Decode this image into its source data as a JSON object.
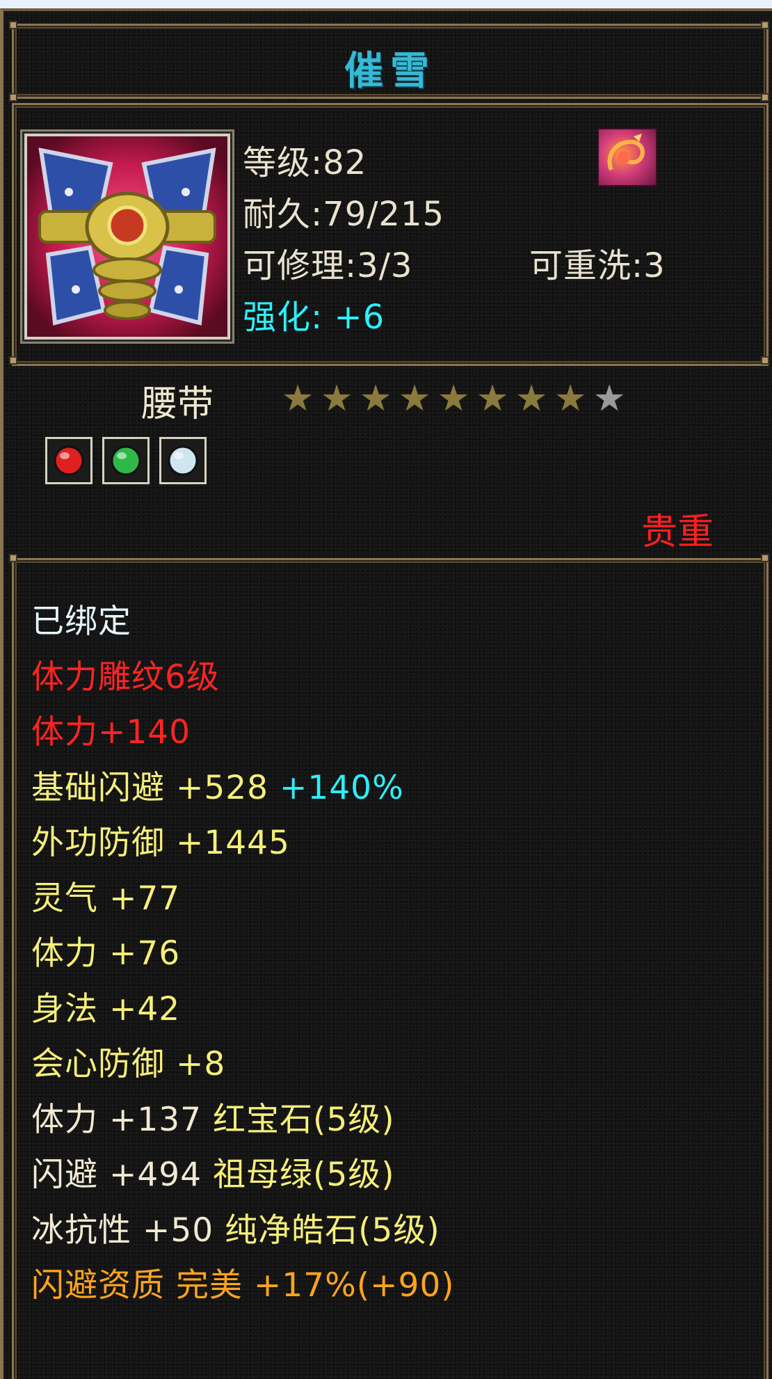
{
  "item": {
    "name": "催雪",
    "level_text": "等级:82",
    "durability_text": "耐久:79/215",
    "repair_text": "可修理:3/3",
    "rewash_text": "可重洗:3",
    "enhance_text": "强化: +6",
    "type": "腰带",
    "quality": "贵重",
    "stars": {
      "filled": 8,
      "total": 9
    },
    "gems": [
      {
        "icon": "ruby-gem-icon",
        "color": "#e02020"
      },
      {
        "icon": "emerald-gem-icon",
        "color": "#2fb84a"
      },
      {
        "icon": "diamond-gem-icon",
        "color": "#cfe6f0"
      }
    ]
  },
  "colors": {
    "title": "#35b9d6",
    "enhance": "#2cf0f8",
    "quality": "#ff1f1f",
    "bound": "#e6f6ff",
    "engrave": "#ff2424",
    "stat": "#f6ef7a",
    "gem_stat": "#f1ead2",
    "aptitude": "#ffa41c"
  },
  "stats": [
    {
      "segments": [
        {
          "text": "已绑定",
          "color": "white"
        }
      ]
    },
    {
      "segments": [
        {
          "text": "体力雕纹6级",
          "color": "red"
        }
      ]
    },
    {
      "segments": [
        {
          "text": "体力+140",
          "color": "red"
        }
      ]
    },
    {
      "segments": [
        {
          "text": "基础闪避 +528 ",
          "color": "yellow"
        },
        {
          "text": "+140%",
          "color": "cyan"
        }
      ]
    },
    {
      "segments": [
        {
          "text": "外功防御 +1445",
          "color": "yellow"
        }
      ]
    },
    {
      "segments": [
        {
          "text": "灵气 +77",
          "color": "yellow"
        }
      ]
    },
    {
      "segments": [
        {
          "text": "体力 +76",
          "color": "yellow"
        }
      ]
    },
    {
      "segments": [
        {
          "text": "身法 +42",
          "color": "yellow"
        }
      ]
    },
    {
      "segments": [
        {
          "text": "会心防御 +8",
          "color": "yellow"
        }
      ]
    },
    {
      "segments": [
        {
          "text": "体力 +137 ",
          "color": "cream"
        },
        {
          "text": "红宝石(5级)",
          "color": "yellow"
        }
      ]
    },
    {
      "segments": [
        {
          "text": "闪避 +494 ",
          "color": "cream"
        },
        {
          "text": "祖母绿(5级)",
          "color": "yellow"
        }
      ]
    },
    {
      "segments": [
        {
          "text": "冰抗性 +50 ",
          "color": "cream"
        },
        {
          "text": "纯净皓石(5级)",
          "color": "yellow"
        }
      ]
    },
    {
      "segments": [
        {
          "text": "闪避资质  完美 +17%(+90)",
          "color": "orange"
        }
      ]
    }
  ]
}
